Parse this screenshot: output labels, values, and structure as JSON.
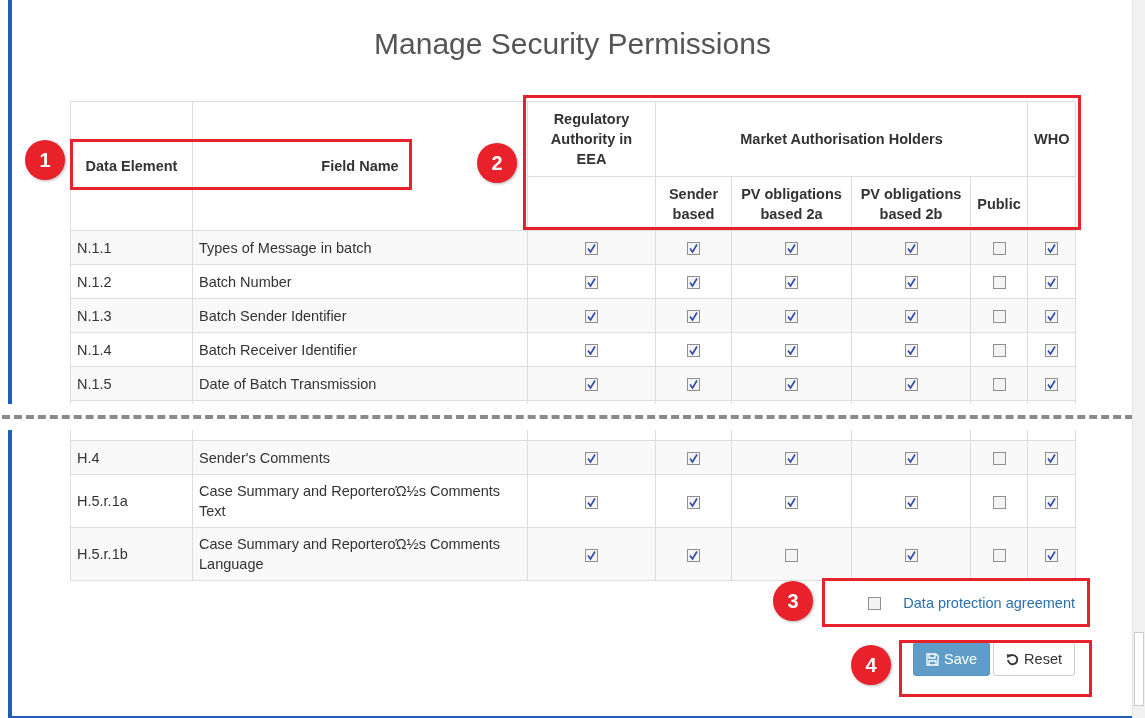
{
  "title": "Manage Security Permissions",
  "table": {
    "columns": [
      {
        "label": "Data Element"
      },
      {
        "label": "Field Name"
      }
    ],
    "groups": [
      {
        "label": "Regulatory Authority in EEA"
      },
      {
        "label": "Market Authorisation Holders",
        "subcolumns": [
          "Sender based",
          "PV obligations based 2a",
          "PV obligations based 2b",
          "Public"
        ]
      },
      {
        "label": "WHO"
      }
    ],
    "rows_top": [
      {
        "element": "N.1.1",
        "field": "Types of Message in batch",
        "permissions": [
          true,
          true,
          true,
          true,
          false,
          true
        ]
      },
      {
        "element": "N.1.2",
        "field": "Batch Number",
        "permissions": [
          true,
          true,
          true,
          true,
          false,
          true
        ]
      },
      {
        "element": "N.1.3",
        "field": "Batch Sender Identifier",
        "permissions": [
          true,
          true,
          true,
          true,
          false,
          true
        ]
      },
      {
        "element": "N.1.4",
        "field": "Batch Receiver Identifier",
        "permissions": [
          true,
          true,
          true,
          true,
          false,
          true
        ]
      },
      {
        "element": "N.1.5",
        "field": "Date of Batch Transmission",
        "permissions": [
          true,
          true,
          true,
          true,
          false,
          true
        ]
      }
    ],
    "rows_bottom": [
      {
        "element": "H.4",
        "field": "Sender's Comments",
        "permissions": [
          true,
          true,
          true,
          true,
          false,
          true
        ]
      },
      {
        "element": "H.5.r.1a",
        "field": "Case Summary and ReporterοΏ½s Comments Text",
        "permissions": [
          true,
          true,
          true,
          true,
          false,
          true
        ]
      },
      {
        "element": "H.5.r.1b",
        "field": "Case Summary and ReporterοΏ½s Comments Language",
        "permissions": [
          true,
          true,
          false,
          true,
          false,
          true
        ]
      }
    ]
  },
  "agreement": {
    "label": "Data protection agreement",
    "checked": false
  },
  "buttons": [
    {
      "label": "Save",
      "kind": "save"
    },
    {
      "label": "Reset",
      "kind": "reset"
    }
  ],
  "callouts": [
    {
      "number": "1"
    },
    {
      "number": "2"
    },
    {
      "number": "3"
    },
    {
      "number": "4"
    }
  ]
}
